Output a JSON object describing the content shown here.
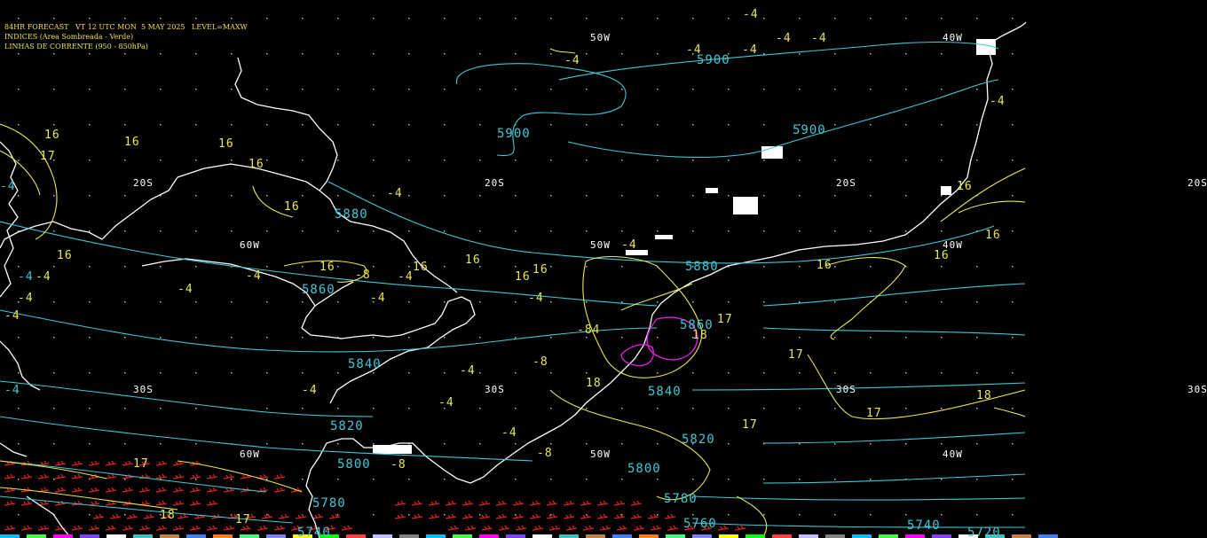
{
  "header": {
    "title": "84HR FORECAST   VT 12 UTC MON  5 MAY 2025   LEVEL=MAXW",
    "line2": "INDICES (Area Sombreada - Verde)",
    "line3": "LINHAS DE CORRENTE (950 - 850hPa)"
  },
  "colors": {
    "background": "#000000",
    "header_text": "#f0e040",
    "coast": "#ffffff",
    "geopotential": "#40c8d8",
    "index_contour": "#e8e850",
    "magenta_contour": "#e020e0",
    "wind_barbs": "#e02020",
    "grid_label": "#ffffff"
  },
  "grid_labels": [
    "50W",
    "40W",
    "20S",
    "20S",
    "20S",
    "20S",
    "60W",
    "50W",
    "40W",
    "30S",
    "30S",
    "30S",
    "30S",
    "60W",
    "50W",
    "40W"
  ],
  "geopotential_labels": [
    "5900",
    "5900",
    "5900",
    "5880",
    "5880",
    "5860",
    "5860",
    "5840",
    "5840",
    "5820",
    "5820",
    "5800",
    "5800",
    "5780",
    "5780",
    "5760",
    "5740",
    "5740",
    "5720"
  ],
  "index_labels": [
    "-4",
    "-4",
    "-4",
    "-4",
    "-4",
    "-4",
    "-4",
    "-4",
    "-4",
    "-4",
    "-4",
    "-4",
    "-4",
    "-4",
    "-4",
    "-4",
    "-4",
    "-4",
    "-4",
    "-4",
    "-4",
    "16",
    "16",
    "16",
    "16",
    "16",
    "16",
    "16",
    "16",
    "16",
    "16",
    "16",
    "16",
    "16",
    "16",
    "16",
    "17",
    "17",
    "17",
    "17",
    "17",
    "17",
    "17",
    "18",
    "18",
    "18",
    "18",
    "-8",
    "-8",
    "-8",
    "-8",
    "-84"
  ]
}
